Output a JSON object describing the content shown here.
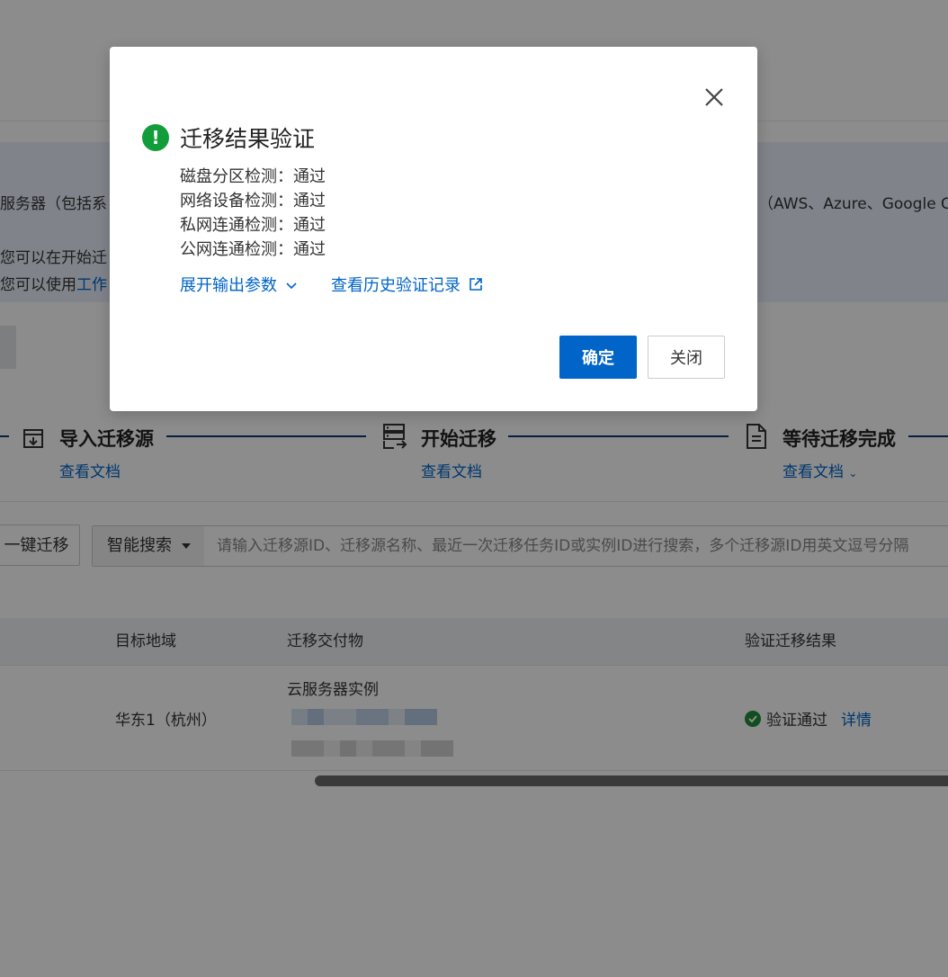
{
  "banner": {
    "line1_left": "服务器（包括系",
    "line1_right": "商（AWS、Azure、Google C",
    "line2": "您可以在开始迁",
    "line3_prefix": "您可以使用",
    "line3_link": "工作"
  },
  "steps": [
    {
      "title": "导入迁移源",
      "doc": "查看文档",
      "icon": "inbox-download-icon"
    },
    {
      "title": "开始迁移",
      "doc": "查看文档",
      "icon": "server-migrate-icon"
    },
    {
      "title": "等待迁移完成",
      "doc": "查看文档",
      "icon": "document-icon"
    }
  ],
  "toolbar": {
    "onekey_label": "一键迁移",
    "smart_search_label": "智能搜索",
    "search_placeholder": "请输入迁移源ID、迁移源名称、最近一次迁移任务ID或实例ID进行搜索，多个迁移源ID用英文逗号分隔"
  },
  "table": {
    "headers": [
      "目标地域",
      "迁移交付物",
      "验证迁移结果"
    ],
    "row": {
      "region": "华东1（杭州）",
      "deliverable_label": "云服务器实例",
      "verify_status": "验证通过",
      "detail_link": "详情"
    }
  },
  "modal": {
    "title": "迁移结果验证",
    "checks": [
      {
        "label": "磁盘分区检测",
        "sep": "：",
        "result": "通过"
      },
      {
        "label": "网络设备检测",
        "sep": "：",
        "result": "通过"
      },
      {
        "label": "私网连通检测",
        "sep": "：",
        "result": "通过"
      },
      {
        "label": "公网连通检测",
        "sep": "：",
        "result": "通过"
      }
    ],
    "expand_link": "展开输出参数",
    "history_link": "查看历史验证记录",
    "ok_label": "确定",
    "close_label": "关闭"
  },
  "colors": {
    "accent": "#0064c8",
    "success": "#139d3a",
    "step_line": "#0a3b7a"
  }
}
